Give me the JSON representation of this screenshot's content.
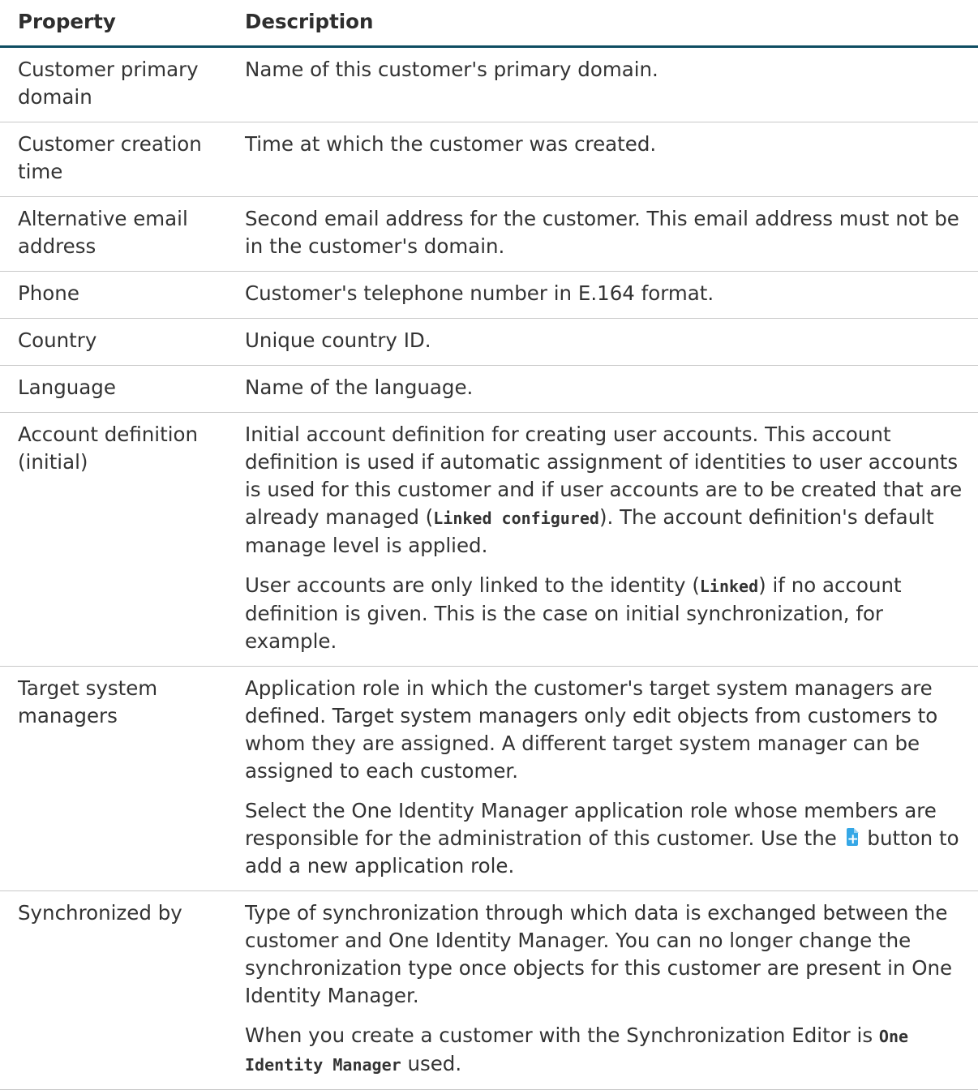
{
  "table": {
    "header": {
      "property": "Property",
      "description": "Description"
    },
    "rows": [
      {
        "property": "Customer primary domain",
        "description": [
          [
            {
              "t": "Name of this customer's primary domain."
            }
          ]
        ]
      },
      {
        "property": "Customer creation time",
        "description": [
          [
            {
              "t": "Time at which the customer was created."
            }
          ]
        ]
      },
      {
        "property": "Alternative email address",
        "description": [
          [
            {
              "t": "Second email address for the customer. This email address must not be in the customer's domain."
            }
          ]
        ]
      },
      {
        "property": "Phone",
        "description": [
          [
            {
              "t": "Customer's telephone number in E.164 format."
            }
          ]
        ]
      },
      {
        "property": "Country",
        "description": [
          [
            {
              "t": "Unique country ID."
            }
          ]
        ]
      },
      {
        "property": "Language",
        "description": [
          [
            {
              "t": "Name of the language."
            }
          ]
        ]
      },
      {
        "property": "Account definition (initial)",
        "description": [
          [
            {
              "t": "Initial account definition for creating user accounts. This account definition is used if automatic assignment of identities to user accounts is used for this customer and if user accounts are to be created that are already managed ("
            },
            {
              "t": "Linked configured",
              "code": true
            },
            {
              "t": "). The account definition's default manage level is applied."
            }
          ],
          [
            {
              "t": "User accounts are only linked to the identity ("
            },
            {
              "t": "Linked",
              "code": true
            },
            {
              "t": ") if no account definition is given. This is the case on initial synchronization, for example."
            }
          ]
        ]
      },
      {
        "property": "Target system managers",
        "description": [
          [
            {
              "t": "Application role in which the customer's target system managers are defined. Target system managers only edit objects from customers to whom they are assigned. A different target system manager can be assigned to each customer."
            }
          ],
          [
            {
              "t": "Select the One Identity Manager application role whose members are responsible for the administration of this customer. Use the "
            },
            {
              "icon": "add-document-icon"
            },
            {
              "t": " button to add a new application role."
            }
          ]
        ]
      },
      {
        "property": "Synchronized by",
        "description": [
          [
            {
              "t": "Type of synchronization through which data is exchanged between the customer and One Identity Manager. You can no longer change the synchronization type once objects for this customer are present in One Identity Manager."
            }
          ],
          [
            {
              "t": "When you create a customer with the Synchronization Editor is "
            },
            {
              "t": "One Identity Manager",
              "code": true
            },
            {
              "t": " used."
            }
          ]
        ]
      }
    ]
  },
  "colors": {
    "header_rule": "#0e4d62",
    "row_rule": "#c8c8c8",
    "text": "#333333",
    "icon": "#35a7e6"
  }
}
